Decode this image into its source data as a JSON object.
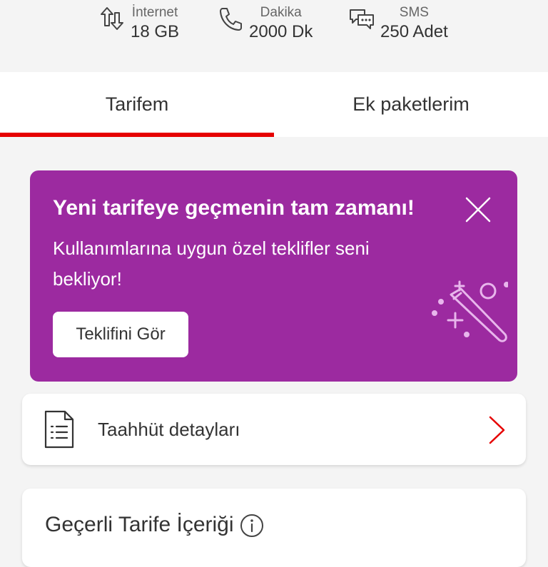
{
  "usage": {
    "internet": {
      "label": "İnternet",
      "value": "18 GB",
      "icon": "data-transfer-icon"
    },
    "minutes": {
      "label": "Dakika",
      "value": "2000 Dk",
      "icon": "phone-icon"
    },
    "sms": {
      "label": "SMS",
      "value": "250 Adet",
      "icon": "chat-bubbles-icon"
    }
  },
  "tabs": [
    {
      "label": "Tarifem",
      "active": true
    },
    {
      "label": "Ek paketlerim",
      "active": false
    }
  ],
  "promo": {
    "title": "Yeni tarifeye geçmenin tam zamanı!",
    "description": "Kullanımlarına uygun özel teklifler seni bekliyor!",
    "button_label": "Teklifini Gör",
    "background_color": "#9c2aa0"
  },
  "commitment": {
    "label": "Taahhüt detayları",
    "icon": "document-icon"
  },
  "tariff_content": {
    "title": "Geçerli Tarife İçeriği",
    "icon": "info-icon"
  },
  "colors": {
    "accent": "#e60000",
    "promo": "#9c2aa0",
    "background": "#f4f4f4"
  }
}
